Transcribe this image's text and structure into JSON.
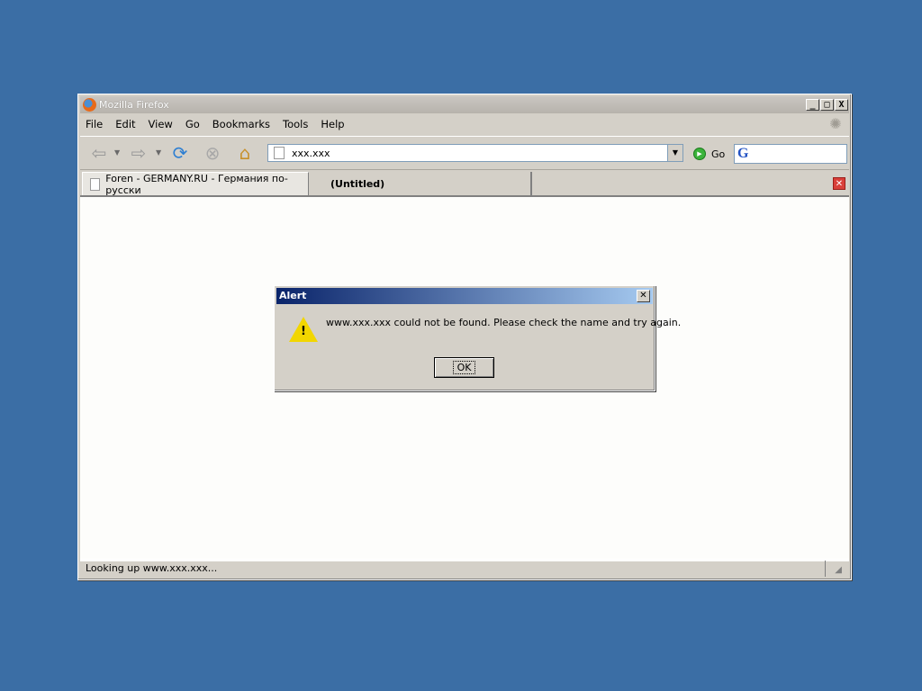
{
  "window": {
    "title": "Mozilla Firefox",
    "controls": {
      "minimize": "_",
      "maximize": "□",
      "close": "X"
    }
  },
  "menu": [
    "File",
    "Edit",
    "View",
    "Go",
    "Bookmarks",
    "Tools",
    "Help"
  ],
  "toolbar": {
    "url": "xxx.xxx",
    "go_label": "Go",
    "icons": [
      "back-icon",
      "forward-icon",
      "reload-icon",
      "stop-icon",
      "home-icon"
    ]
  },
  "tabs": [
    {
      "label": "Foren - GERMANY.RU - Германия по-русски",
      "active": false
    },
    {
      "label": "(Untitled)",
      "active": true
    }
  ],
  "status": {
    "text": "Looking up www.xxx.xxx..."
  },
  "alert": {
    "title": "Alert",
    "message": "www.xxx.xxx could not be found. Please check the name and try again.",
    "ok_label": "OK"
  },
  "colors": {
    "desktop": "#3b6ea5",
    "dialog_title_start": "#0a246a",
    "dialog_title_end": "#a6caf0",
    "warning": "#f2d600"
  }
}
